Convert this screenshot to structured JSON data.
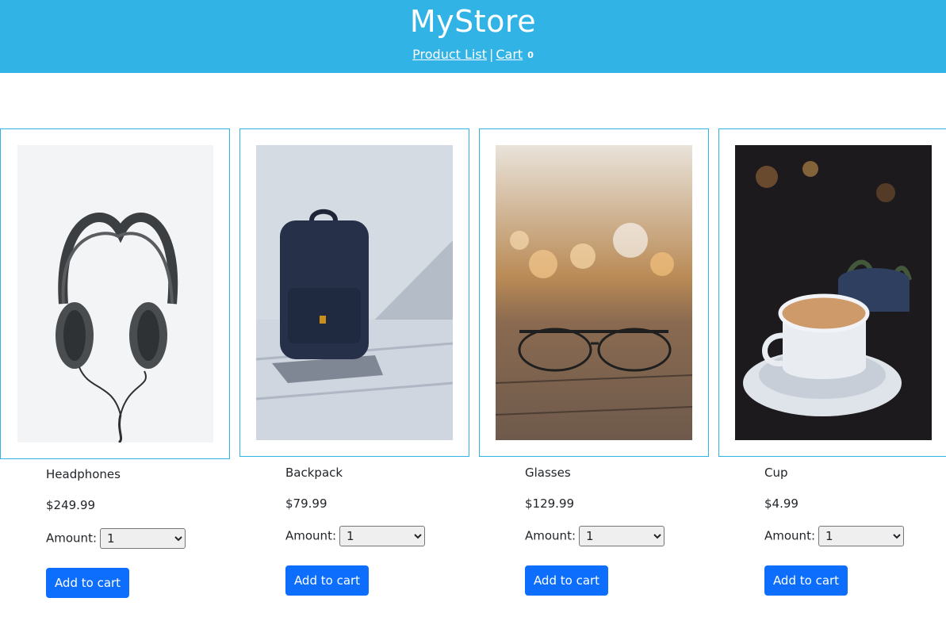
{
  "header": {
    "brand": "MyStore",
    "nav_product_list": "Product List",
    "nav_separator": "|",
    "nav_cart": "Cart",
    "cart_count": "0",
    "background_color": "#31b3e6"
  },
  "products": [
    {
      "name": "Headphones",
      "price": "$249.99",
      "amount_label": "Amount:",
      "amount_value": "1",
      "button_label": "Add to cart"
    },
    {
      "name": "Backpack",
      "price": "$79.99",
      "amount_label": "Amount:",
      "amount_value": "1",
      "button_label": "Add to cart"
    },
    {
      "name": "Glasses",
      "price": "$129.99",
      "amount_label": "Amount:",
      "amount_value": "1",
      "button_label": "Add to cart"
    },
    {
      "name": "Cup",
      "price": "$4.99",
      "amount_label": "Amount:",
      "amount_value": "1",
      "button_label": "Add to cart"
    }
  ],
  "colors": {
    "accent": "#31b3e6",
    "button": "#0d6efd"
  }
}
